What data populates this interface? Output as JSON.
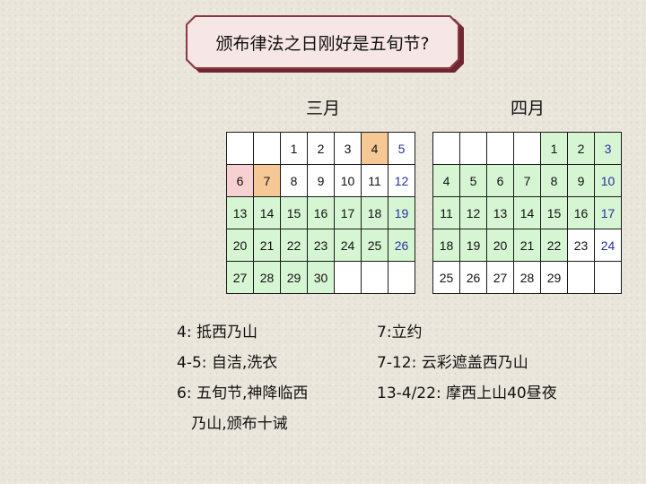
{
  "title": "颁布律法之日刚好是五旬节?",
  "march": {
    "label": "三月",
    "rows": [
      [
        {
          "d": "",
          "c": ""
        },
        {
          "d": "",
          "c": ""
        },
        {
          "d": "1",
          "c": ""
        },
        {
          "d": "2",
          "c": ""
        },
        {
          "d": "3",
          "c": ""
        },
        {
          "d": "4",
          "c": "o"
        },
        {
          "d": "5",
          "c": "sat"
        }
      ],
      [
        {
          "d": "6",
          "c": "p"
        },
        {
          "d": "7",
          "c": "o"
        },
        {
          "d": "8",
          "c": ""
        },
        {
          "d": "9",
          "c": ""
        },
        {
          "d": "10",
          "c": ""
        },
        {
          "d": "11",
          "c": ""
        },
        {
          "d": "12",
          "c": "sat"
        }
      ],
      [
        {
          "d": "13",
          "c": "g"
        },
        {
          "d": "14",
          "c": "g"
        },
        {
          "d": "15",
          "c": "g"
        },
        {
          "d": "16",
          "c": "g"
        },
        {
          "d": "17",
          "c": "g"
        },
        {
          "d": "18",
          "c": "g"
        },
        {
          "d": "19",
          "c": "g sat"
        }
      ],
      [
        {
          "d": "20",
          "c": "g"
        },
        {
          "d": "21",
          "c": "g"
        },
        {
          "d": "22",
          "c": "g"
        },
        {
          "d": "23",
          "c": "g"
        },
        {
          "d": "24",
          "c": "g"
        },
        {
          "d": "25",
          "c": "g"
        },
        {
          "d": "26",
          "c": "g sat"
        }
      ],
      [
        {
          "d": "27",
          "c": "g"
        },
        {
          "d": "28",
          "c": "g"
        },
        {
          "d": "29",
          "c": "g"
        },
        {
          "d": "30",
          "c": "g"
        },
        {
          "d": "",
          "c": ""
        },
        {
          "d": "",
          "c": ""
        },
        {
          "d": "",
          "c": ""
        }
      ]
    ]
  },
  "april": {
    "label": "四月",
    "rows": [
      [
        {
          "d": "",
          "c": ""
        },
        {
          "d": "",
          "c": ""
        },
        {
          "d": "",
          "c": ""
        },
        {
          "d": "",
          "c": ""
        },
        {
          "d": "1",
          "c": "g"
        },
        {
          "d": "2",
          "c": "g"
        },
        {
          "d": "3",
          "c": "g sat"
        }
      ],
      [
        {
          "d": "4",
          "c": "g"
        },
        {
          "d": "5",
          "c": "g"
        },
        {
          "d": "6",
          "c": "g"
        },
        {
          "d": "7",
          "c": "g"
        },
        {
          "d": "8",
          "c": "g"
        },
        {
          "d": "9",
          "c": "g"
        },
        {
          "d": "10",
          "c": "g sat"
        }
      ],
      [
        {
          "d": "11",
          "c": "g"
        },
        {
          "d": "12",
          "c": "g"
        },
        {
          "d": "13",
          "c": "g"
        },
        {
          "d": "14",
          "c": "g"
        },
        {
          "d": "15",
          "c": "g"
        },
        {
          "d": "16",
          "c": "g"
        },
        {
          "d": "17",
          "c": "g sat"
        }
      ],
      [
        {
          "d": "18",
          "c": "g"
        },
        {
          "d": "19",
          "c": "g"
        },
        {
          "d": "20",
          "c": "g"
        },
        {
          "d": "21",
          "c": "g"
        },
        {
          "d": "22",
          "c": "g"
        },
        {
          "d": "23",
          "c": ""
        },
        {
          "d": "24",
          "c": "sat"
        }
      ],
      [
        {
          "d": "25",
          "c": ""
        },
        {
          "d": "26",
          "c": ""
        },
        {
          "d": "27",
          "c": ""
        },
        {
          "d": "28",
          "c": ""
        },
        {
          "d": "29",
          "c": ""
        },
        {
          "d": "",
          "c": ""
        },
        {
          "d": "",
          "c": ""
        }
      ]
    ]
  },
  "notes_left": [
    "4: 抵西乃山",
    "4-5: 自洁,洗衣",
    "6: 五旬节,神降临西",
    "   乃山,颁布十诫"
  ],
  "notes_right": [
    "7:立约",
    "7-12: 云彩遮盖西乃山",
    "13-4/22: 摩西上山40昼夜"
  ],
  "colors": {
    "green_cell": "#d6f5d3",
    "orange_cell": "#f6c896",
    "pink_cell": "#f7d0d2",
    "saturday_text": "#2b2f9c",
    "title_border": "#8a3a44",
    "title_fill": "#f7e6e6"
  }
}
